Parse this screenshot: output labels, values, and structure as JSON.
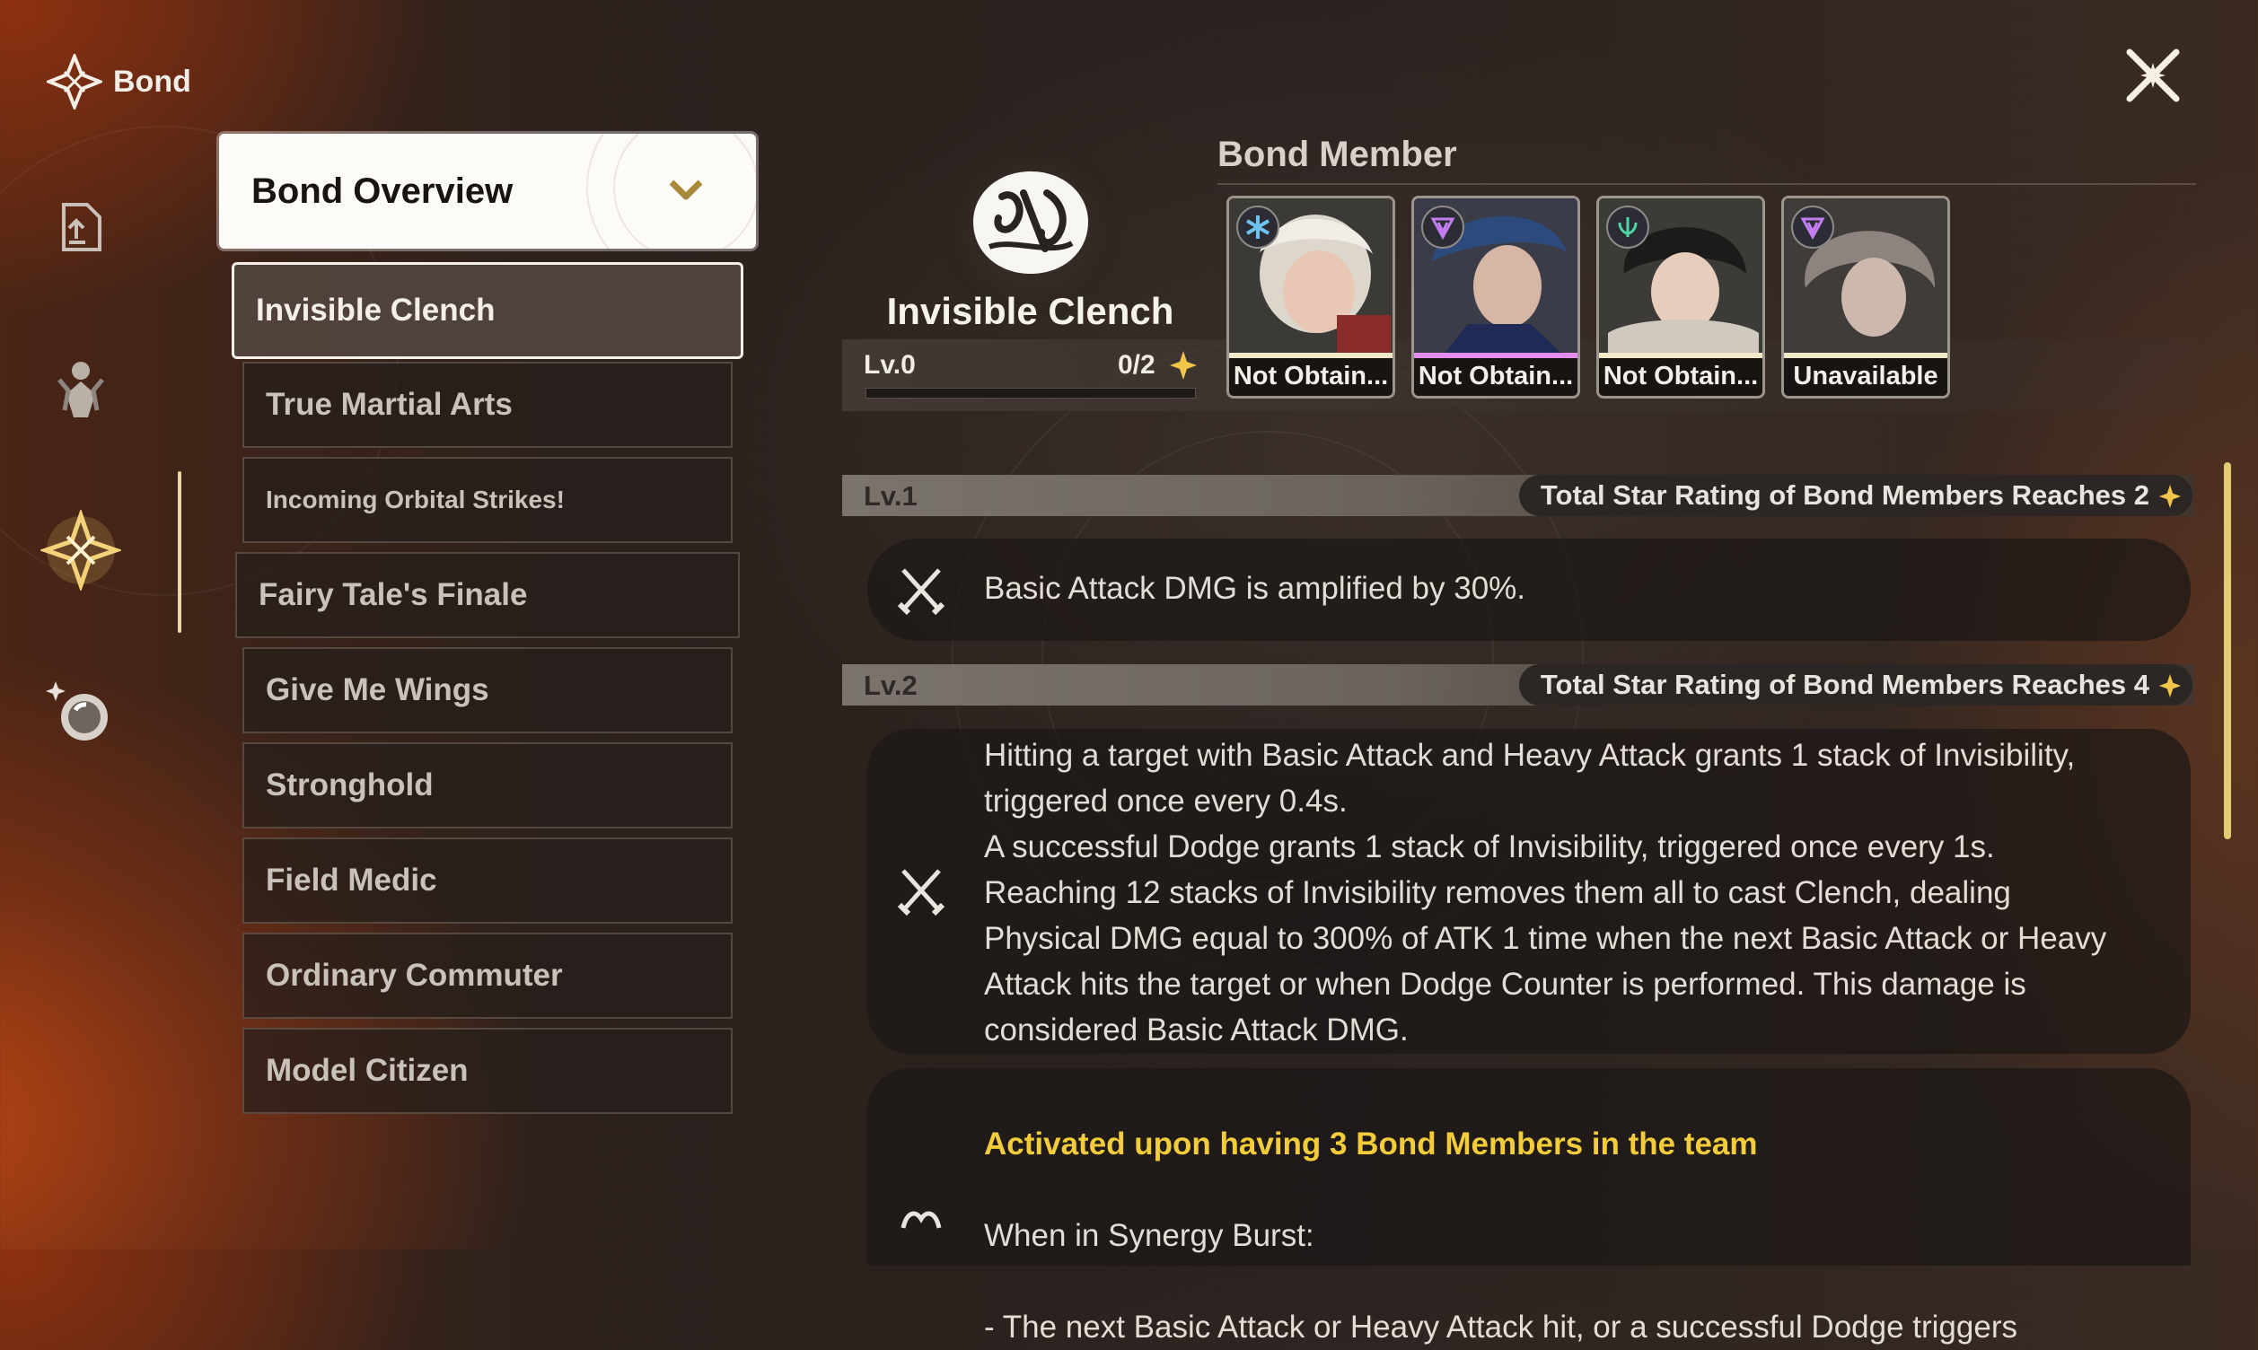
{
  "header": {
    "title": "Bond"
  },
  "sidebar": {
    "items": [
      {
        "icon": "upload-icon",
        "active": false
      },
      {
        "icon": "characters-icon",
        "active": false
      },
      {
        "icon": "bond-icon",
        "active": true
      },
      {
        "icon": "orb-icon",
        "active": false
      }
    ]
  },
  "bond_list": {
    "overview_label": "Bond Overview",
    "items": [
      {
        "label": "Invisible Clench",
        "selected": true
      },
      {
        "label": "True Martial Arts"
      },
      {
        "label": "Incoming Orbital Strikes!"
      },
      {
        "label": "Fairy Tale's Finale"
      },
      {
        "label": "Give Me Wings"
      },
      {
        "label": "Stronghold"
      },
      {
        "label": "Field Medic"
      },
      {
        "label": "Ordinary Commuter"
      },
      {
        "label": "Model Citizen"
      }
    ]
  },
  "bond": {
    "name": "Invisible Clench",
    "level_label": "Lv.0",
    "progress": "0/2",
    "progress_fraction": 0.0,
    "members_title": "Bond Member",
    "members": [
      {
        "status": "Not Obtain...",
        "element_icon": "ice-icon",
        "rarity_color": "#f1e9c8"
      },
      {
        "status": "Not Obtain...",
        "element_icon": "void-icon",
        "rarity_color": "#e28cf0"
      },
      {
        "status": "Not Obtain...",
        "element_icon": "wind-icon",
        "rarity_color": "#f1e9c8"
      },
      {
        "status": "Unavailable",
        "element_icon": "void-icon",
        "rarity_color": "#f1e9c8"
      }
    ]
  },
  "levels": [
    {
      "label": "Lv.1",
      "requirement": "Total Star Rating of Bond Members Reaches 2",
      "effect": "Basic Attack DMG is amplified by 30%."
    },
    {
      "label": "Lv.2",
      "requirement": "Total Star Rating of Bond Members Reaches 4",
      "effect": "Hitting a target with Basic Attack and Heavy Attack grants 1 stack of Invisibility,\ntriggered once every 0.4s.\nA successful Dodge grants 1 stack of Invisibility, triggered once every 1s.\nReaching 12 stacks of Invisibility removes them all to cast Clench, dealing\nPhysical DMG equal to 300% of ATK 1 time when the next Basic Attack or Heavy\nAttack hits the target or when Dodge Counter is performed. This damage is\nconsidered Basic Attack DMG."
    }
  ],
  "team_effect": {
    "condition": "Activated upon having 3 Bond Members in the team",
    "line1": "When in Synergy Burst:",
    "line2": "- The next Basic Attack or Heavy Attack hit, or a successful Dodge triggers"
  },
  "colors": {
    "accent_gold": "#e3cc74",
    "highlight_yellow": "#f3cc3a"
  }
}
